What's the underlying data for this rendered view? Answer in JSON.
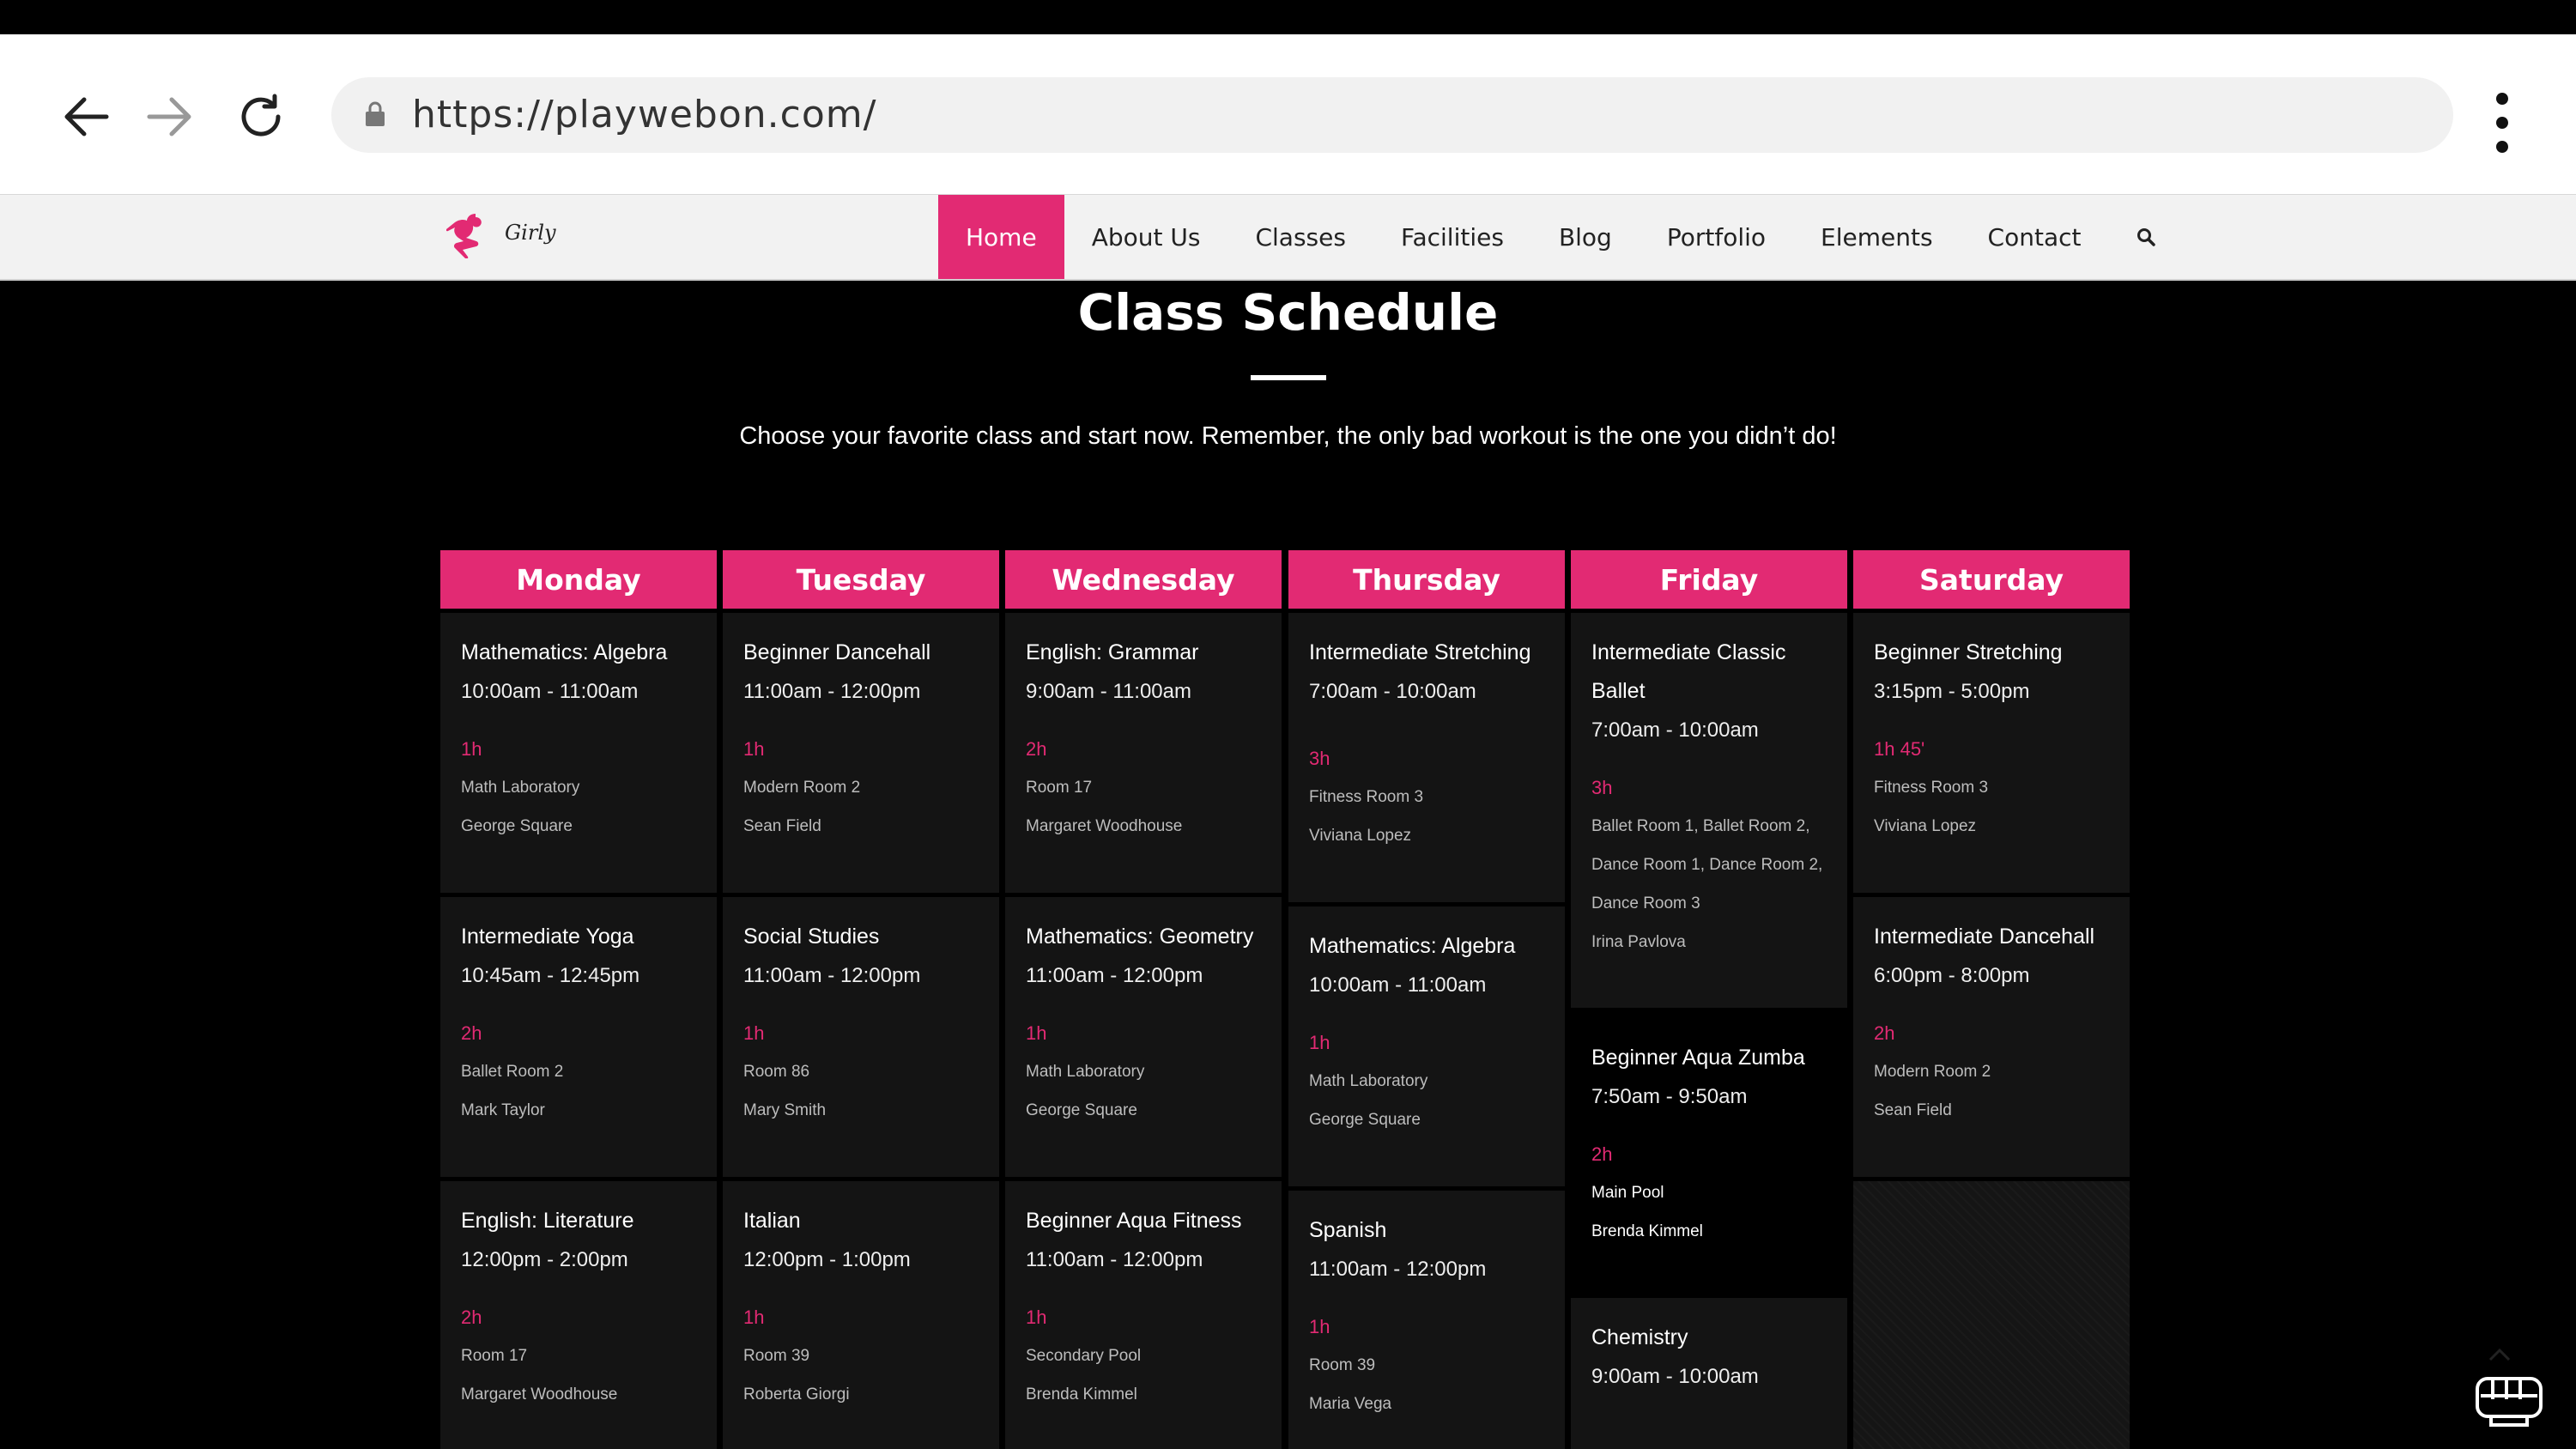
{
  "browser": {
    "url": "https://playwebon.com/"
  },
  "site": {
    "logo_text": "Girly",
    "nav": [
      {
        "label": "Home",
        "active": true
      },
      {
        "label": "About Us"
      },
      {
        "label": "Classes"
      },
      {
        "label": "Facilities"
      },
      {
        "label": "Blog"
      },
      {
        "label": "Portfolio"
      },
      {
        "label": "Elements"
      },
      {
        "label": "Contact"
      }
    ]
  },
  "schedule": {
    "title": "Class Schedule",
    "subtitle": "Choose your favorite class and start now. Remember, the only bad workout is the one you didn’t do!",
    "days": [
      "Monday",
      "Tuesday",
      "Wednesday",
      "Thursday",
      "Friday",
      "Saturday"
    ],
    "columns": [
      [
        {
          "name": "Mathematics: Algebra",
          "time": "10:00am - 11:00am",
          "duration": "1h",
          "room": "Math Laboratory",
          "teacher": "George Square"
        },
        {
          "name": "Intermediate Yoga",
          "time": "10:45am - 12:45pm",
          "duration": "2h",
          "room": "Ballet Room 2",
          "teacher": "Mark Taylor"
        },
        {
          "name": "English: Literature",
          "time": "12:00pm - 2:00pm",
          "duration": "2h",
          "room": "Room 17",
          "teacher": "Margaret Woodhouse"
        }
      ],
      [
        {
          "name": "Beginner Dancehall",
          "time": "11:00am - 12:00pm",
          "duration": "1h",
          "room": "Modern Room 2",
          "teacher": "Sean Field"
        },
        {
          "name": "Social Studies",
          "time": "11:00am - 12:00pm",
          "duration": "1h",
          "room": "Room 86",
          "teacher": "Mary Smith"
        },
        {
          "name": "Italian",
          "time": "12:00pm - 1:00pm",
          "duration": "1h",
          "room": "Room 39",
          "teacher": "Roberta Giorgi"
        }
      ],
      [
        {
          "name": "English: Grammar",
          "time": "9:00am - 11:00am",
          "duration": "2h",
          "room": "Room 17",
          "teacher": "Margaret Woodhouse"
        },
        {
          "name": "Mathematics: Geometry",
          "time": "11:00am - 12:00pm",
          "duration": "1h",
          "room": "Math Laboratory",
          "teacher": "George Square"
        },
        {
          "name": "Beginner Aqua Fitness",
          "time": "11:00am - 12:00pm",
          "duration": "1h",
          "room": "Secondary Pool",
          "teacher": "Brenda Kimmel"
        }
      ],
      [
        {
          "name": "Intermediate Stretching",
          "time": "7:00am - 10:00am",
          "duration": "3h",
          "room": "Fitness Room 3",
          "teacher": "Viviana Lopez"
        },
        {
          "name": "Mathematics: Algebra",
          "time": "10:00am - 11:00am",
          "duration": "1h",
          "room": "Math Laboratory",
          "teacher": "George Square"
        },
        {
          "name": "Spanish",
          "time": "11:00am - 12:00pm",
          "duration": "1h",
          "room": "Room 39",
          "teacher": "Maria Vega"
        }
      ],
      [
        {
          "name": "Intermediate Classic Ballet",
          "time": "7:00am - 10:00am",
          "duration": "3h",
          "room": "Ballet Room 1, Ballet Room 2, Dance Room 1, Dance Room 2, Dance Room 3",
          "teacher": "Irina Pavlova"
        },
        {
          "name": "Beginner Aqua Zumba",
          "time": "7:50am - 9:50am",
          "duration": "2h",
          "room": "Main Pool",
          "teacher": "Brenda Kimmel"
        },
        {
          "name": "Chemistry",
          "time": "9:00am - 10:00am"
        }
      ],
      [
        {
          "name": "Beginner Stretching",
          "time": "3:15pm - 5:00pm",
          "duration": "1h 45'",
          "room": "Fitness Room 3",
          "teacher": "Viviana Lopez"
        },
        {
          "name": "Intermediate Dancehall",
          "time": "6:00pm - 8:00pm",
          "duration": "2h",
          "room": "Modern Room 2",
          "teacher": "Sean Field"
        }
      ]
    ]
  },
  "colors": {
    "accent": "#e22a73",
    "cell_bg": "#141414",
    "page_bg": "#000000"
  },
  "icons": {
    "back": "arrow-left-icon",
    "forward": "arrow-right-icon",
    "reload": "reload-icon",
    "lock": "lock-icon",
    "menu": "kebab-menu-icon",
    "search": "search-icon",
    "scroll_top": "chevron-up-icon",
    "fist": "fist-icon"
  }
}
